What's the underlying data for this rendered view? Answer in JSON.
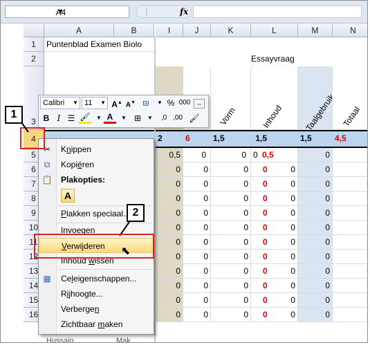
{
  "formula_bar": {
    "name_box": "A4",
    "fx": "fx"
  },
  "columns": [
    "A",
    "B",
    "I",
    "J",
    "K",
    "L",
    "M",
    "N"
  ],
  "rows": [
    "1",
    "2",
    "3",
    "4",
    "5",
    "6",
    "7",
    "8",
    "9",
    "10",
    "11",
    "12",
    "13",
    "14",
    "15",
    "16"
  ],
  "sheet": {
    "title": "Puntenblad Examen Biolo",
    "section": "Essayvraag",
    "headers": [
      "Vorm",
      "Inhoud",
      "Taalgebruik",
      "Totaal"
    ],
    "row4": [
      "2",
      "6",
      "1,5",
      "1,5",
      "1,5",
      "4,5"
    ],
    "row5": [
      "0,5",
      "0",
      "0",
      "0,5",
      "0",
      "0"
    ],
    "zero": "0"
  },
  "mini_toolbar": {
    "font": "Calibri",
    "size": "11"
  },
  "context_menu": {
    "cut": "Knippen",
    "copy": "Kopiëren",
    "paste_options": "Plakopties:",
    "paste_special": "Plakken speciaal...",
    "insert": "Invoegen",
    "delete": "Verwijderen",
    "clear": "Inhoud wissen",
    "format_cells": "Celeigenschappen...",
    "row_height": "Rijhoogte...",
    "hide": "Verbergen",
    "unhide": "Zichtbaar maken"
  },
  "callouts": [
    "1",
    "2"
  ],
  "bottom_fragments": [
    "Hussain...",
    "Mak..."
  ]
}
